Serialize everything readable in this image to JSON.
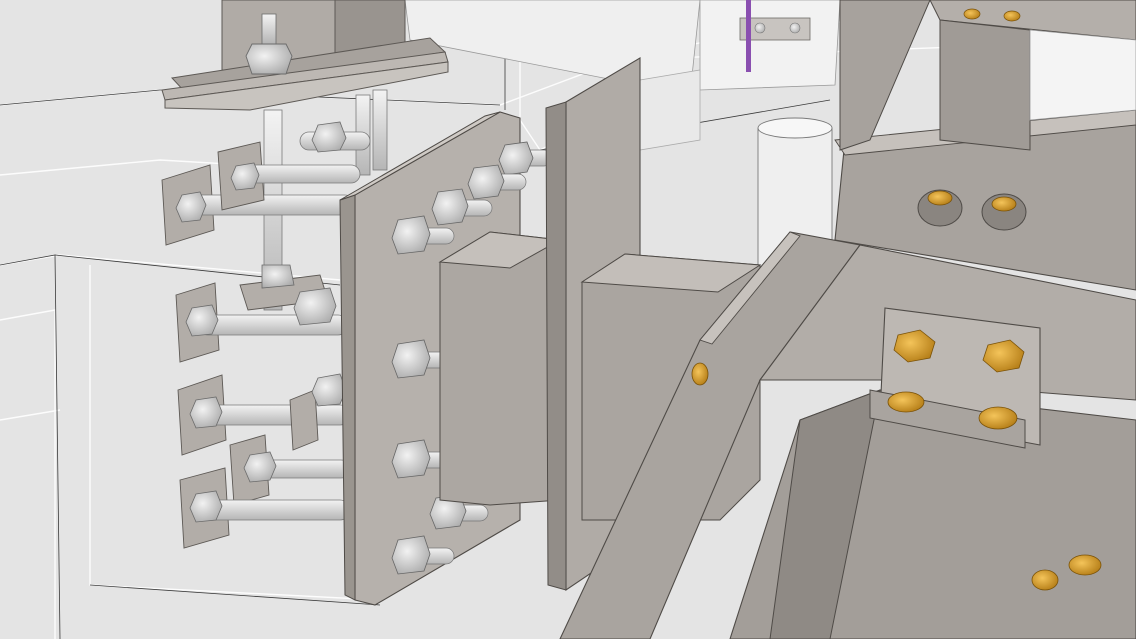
{
  "scene": {
    "background": "#e4e4e4",
    "steel_color": "#a29d98",
    "steel_dark": "#8d8883",
    "bolt_color": "#d0d0d0",
    "brass_bolt_color": "#d8a02a",
    "concrete_wire_color": "#ffffff",
    "accent_rod_color": "#8a4fb0",
    "icons": [
      "bolt-icon",
      "anchor-rod-icon",
      "brass-bolt-icon"
    ]
  }
}
